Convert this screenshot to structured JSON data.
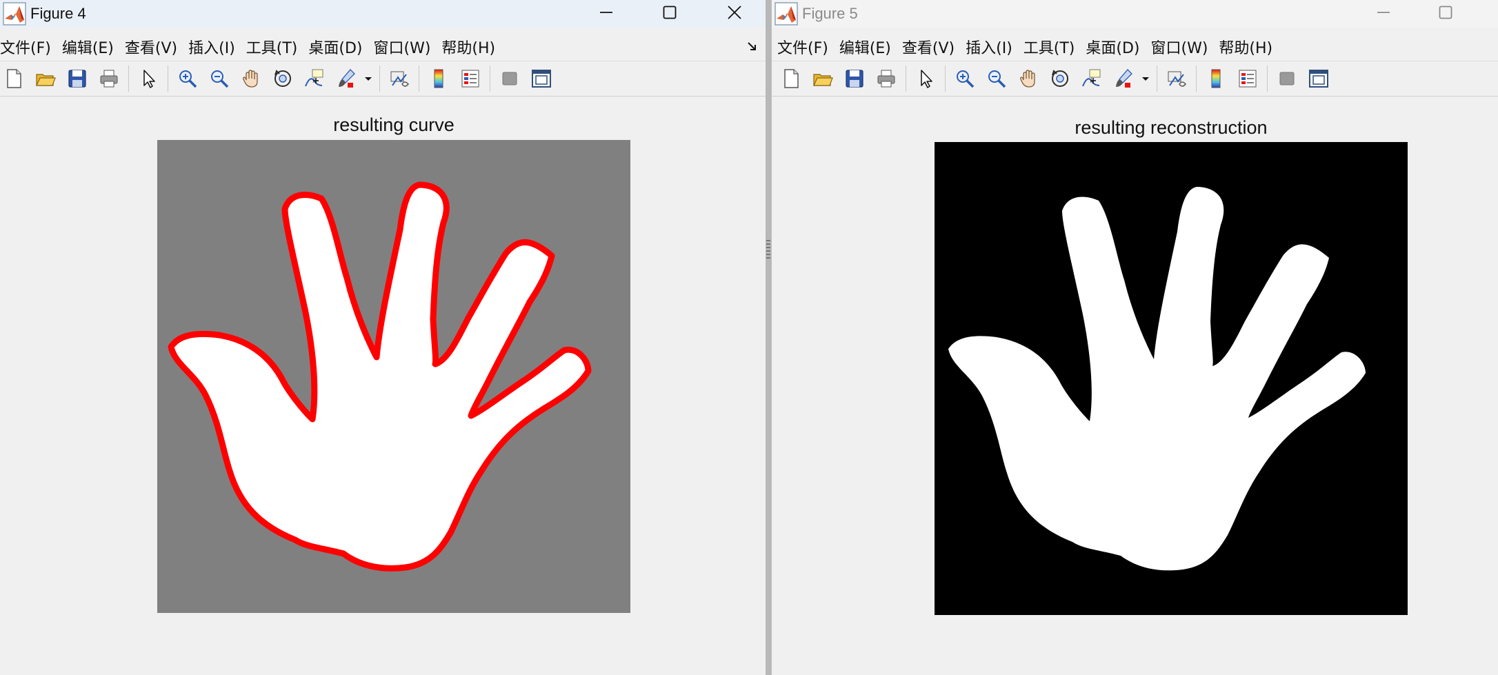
{
  "windows": [
    {
      "id": "figure4",
      "title": "Figure 4",
      "active": true,
      "axes_title": "resulting curve",
      "image": {
        "background": "#808080",
        "shape_fill": "#ffffff",
        "contour_color": "#ff0000",
        "contour_visible": true
      }
    },
    {
      "id": "figure5",
      "title": "Figure 5",
      "active": false,
      "axes_title": "resulting reconstruction",
      "image": {
        "background": "#000000",
        "shape_fill": "#ffffff",
        "contour_color": "",
        "contour_visible": false
      }
    }
  ],
  "menu": [
    "文件(F)",
    "编辑(E)",
    "查看(V)",
    "插入(I)",
    "工具(T)",
    "桌面(D)",
    "窗口(W)",
    "帮助(H)"
  ],
  "toolbar_icons": [
    "new-figure-icon",
    "open-file-icon",
    "save-icon",
    "print-icon",
    "|",
    "edit-plot-arrow-icon",
    "|",
    "zoom-in-icon",
    "zoom-out-icon",
    "pan-hand-icon",
    "rotate-3d-icon",
    "data-cursor-icon",
    "brush-icon",
    "v",
    "|",
    "link-plot-icon",
    "|",
    "colorbar-icon",
    "legend-icon",
    "|",
    "hide-plot-tools-icon",
    "show-plot-tools-icon"
  ],
  "colors": {
    "matlab_orange": "#e16737",
    "matlab_red": "#b5231a",
    "contour_red": "#ff0000"
  }
}
